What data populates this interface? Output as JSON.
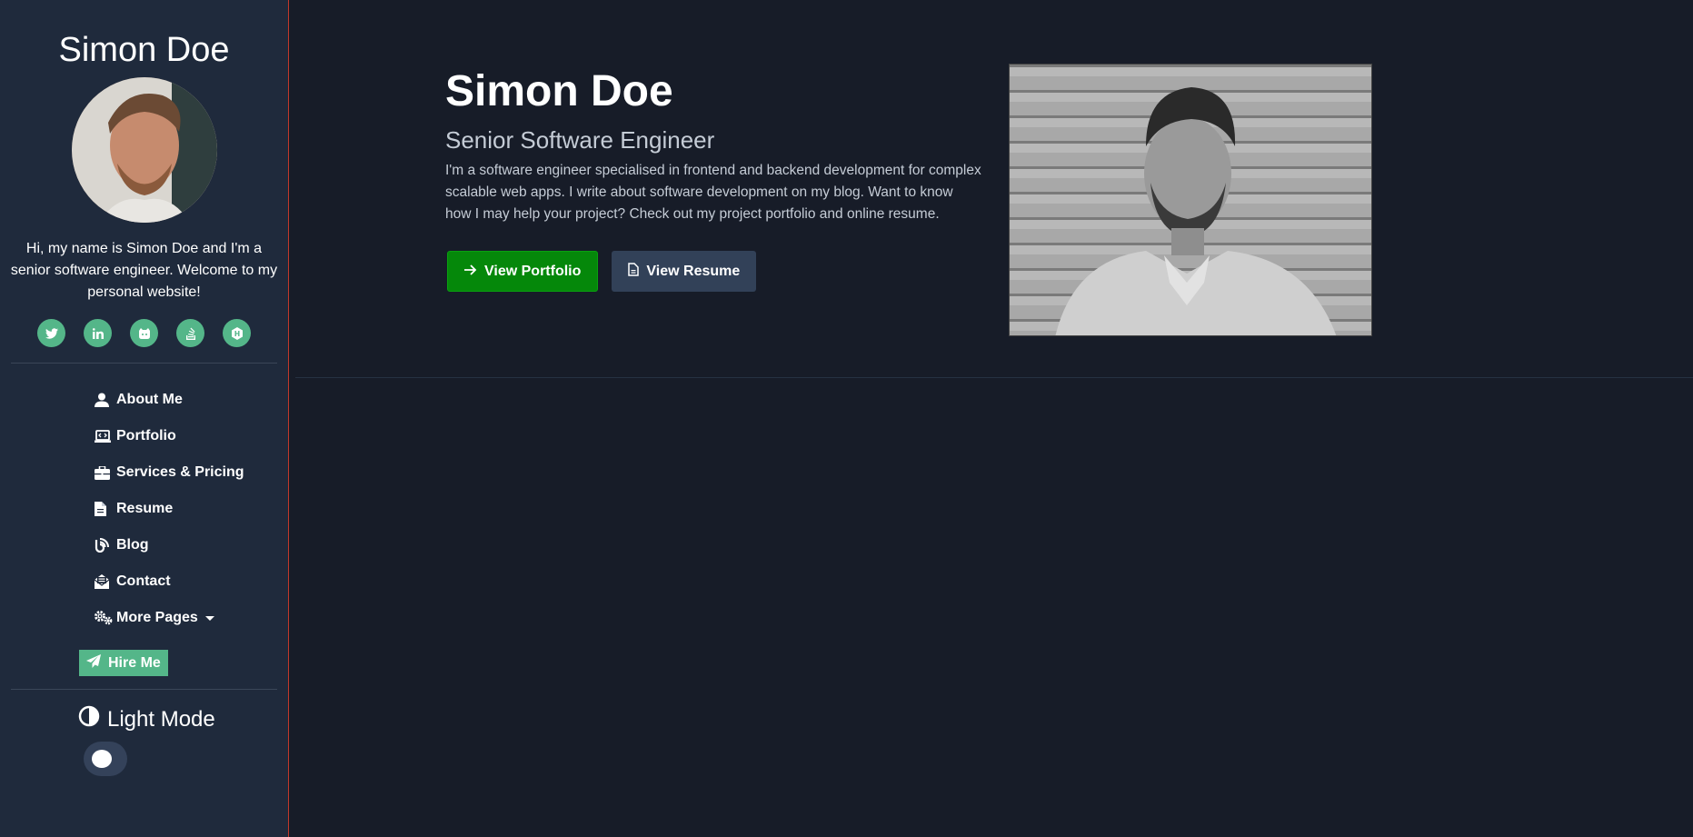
{
  "sidebar": {
    "name": "Simon Doe",
    "bio": "Hi, my name is Simon Doe and I'm a senior software engineer. Welcome to my personal website!",
    "social_icons": [
      "twitter-icon",
      "linkedin-icon",
      "github-icon",
      "stack-overflow-icon",
      "hacker-rank-icon"
    ],
    "nav": [
      {
        "label": "About Me",
        "icon": "user-icon"
      },
      {
        "label": "Portfolio",
        "icon": "laptop-code-icon"
      },
      {
        "label": "Services & Pricing",
        "icon": "briefcase-icon"
      },
      {
        "label": "Resume",
        "icon": "file-icon"
      },
      {
        "label": "Blog",
        "icon": "blog-icon"
      },
      {
        "label": "Contact",
        "icon": "envelope-open-icon"
      },
      {
        "label": "More Pages",
        "icon": "cogs-icon"
      }
    ],
    "hire_label": "Hire Me",
    "mode_label": "Light Mode"
  },
  "hero": {
    "name": "Simon Doe",
    "title": "Senior Software Engineer",
    "text": "I'm a software engineer specialised in frontend and backend development for complex scalable web apps. I write about software development on my blog. Want to know how I may help your project? Check out my project portfolio and online resume.",
    "primary_button": "View Portfolio",
    "secondary_button": "View Resume"
  },
  "colors": {
    "background": "#171c28",
    "sidebar": "#1f2a3c",
    "accent": "#54b689",
    "primary_button": "#05880a"
  }
}
